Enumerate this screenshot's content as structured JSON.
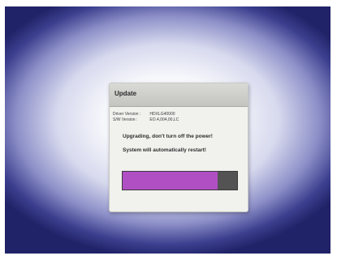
{
  "dialog": {
    "title": "Update",
    "driver_version_label": "Driver Version :",
    "driver_version_value": "HDXLG40000",
    "sw_version_label": "S/W Version :",
    "sw_version_value": "EO.4,004,00,LC",
    "warning_message": "Upgrading, don't turn off the power!",
    "restart_message": "System will automatically restart!"
  },
  "progress": {
    "percent": 83,
    "fill_color": "#b04ec4",
    "track_color": "#535353"
  },
  "colors": {
    "background_center": "#ffffff",
    "background_edge": "#202367",
    "dialog_background": "#f1f1ee"
  }
}
